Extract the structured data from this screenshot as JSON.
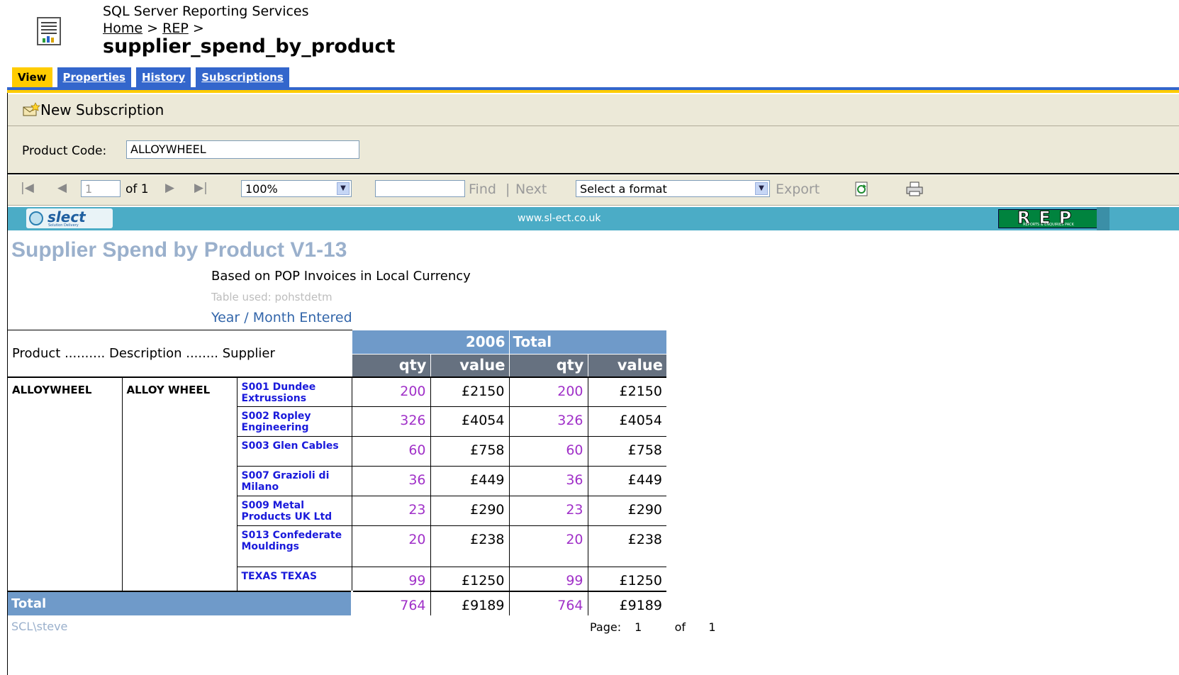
{
  "header": {
    "app_title": "SQL Server Reporting Services",
    "crumb_home": "Home",
    "crumb_sep1": ">",
    "crumb_folder": "REP",
    "crumb_sep2": ">",
    "report_name": "supplier_spend_by_product"
  },
  "tabs": {
    "view": "View",
    "properties": "Properties",
    "history": "History",
    "subscriptions": "Subscriptions"
  },
  "subscription_bar": {
    "new_subscription": "New Subscription"
  },
  "parameters": {
    "product_code_label": "Product Code:",
    "product_code_value": "ALLOYWHEEL"
  },
  "toolbar": {
    "page_current": "1",
    "page_of": "of 1",
    "zoom": "100%",
    "find_value": "",
    "find_label": "Find",
    "find_sep": "|",
    "next_label": "Next",
    "format_select": "Select a format",
    "export_label": "Export"
  },
  "banner": {
    "left_logo_text": "slect",
    "left_logo_tag": "Solution Delivery",
    "url": "www.sl-ect.co.uk",
    "right_logo_text": "REP",
    "right_logo_tag": "REPORTS & ENQUIRIES PACK"
  },
  "report": {
    "title": "Supplier Spend by Product V1-13",
    "subtitle": "Based on POP Invoices in Local Currency",
    "table_used": "Table used:  pohstdetm",
    "year_month": "Year / Month Entered",
    "row_header": "Product .......... Description ........ Supplier",
    "year": "2006",
    "total_header": "Total",
    "qty_label": "qty",
    "value_label": "value",
    "product": "ALLOYWHEEL",
    "description": "ALLOY WHEEL",
    "rows": [
      {
        "supplier": "S001 Dundee Extrussions",
        "qty": "200",
        "value": "£2150",
        "tqty": "200",
        "tvalue": "£2150"
      },
      {
        "supplier": "S002 Ropley Engineering",
        "qty": "326",
        "value": "£4054",
        "tqty": "326",
        "tvalue": "£4054"
      },
      {
        "supplier": "S003 Glen Cables",
        "qty": "60",
        "value": "£758",
        "tqty": "60",
        "tvalue": "£758"
      },
      {
        "supplier": "S007 Grazioli di Milano",
        "qty": "36",
        "value": "£449",
        "tqty": "36",
        "tvalue": "£449"
      },
      {
        "supplier": "S009 Metal Products UK Ltd",
        "qty": "23",
        "value": "£290",
        "tqty": "23",
        "tvalue": "£290"
      },
      {
        "supplier": "S013 Confederate Mouldings",
        "qty": "20",
        "value": "£238",
        "tqty": "20",
        "tvalue": "£238"
      },
      {
        "supplier": "TEXAS TEXAS",
        "qty": "99",
        "value": "£1250",
        "tqty": "99",
        "tvalue": "£1250"
      }
    ],
    "total_label": "Total",
    "total_qty": "764",
    "total_value": "£9189",
    "total_tqty": "764",
    "total_tvalue": "£9189"
  },
  "footer": {
    "user": "SCL\\steve",
    "page_label": "Page:",
    "page_num": "1",
    "of_label": "of",
    "page_total": "1"
  }
}
